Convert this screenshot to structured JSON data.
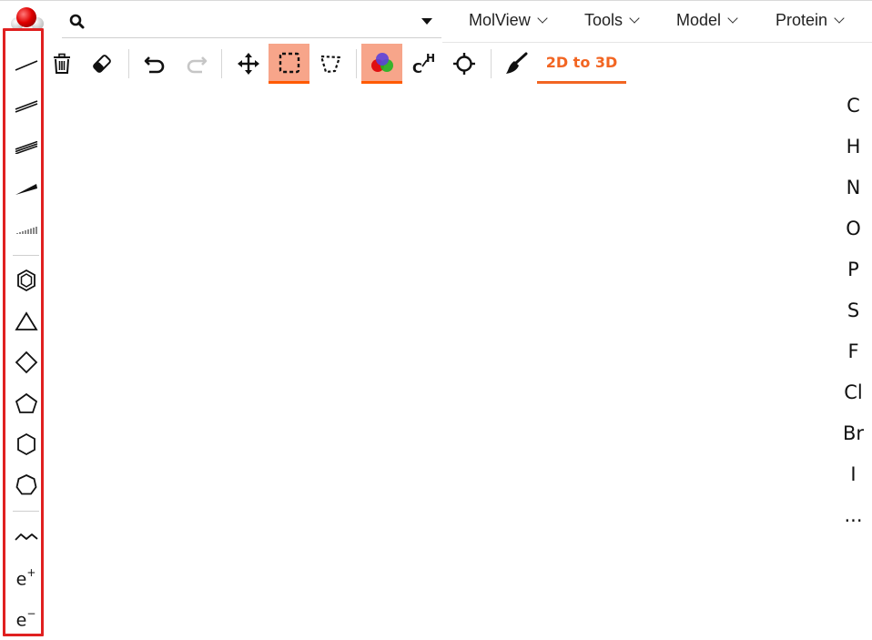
{
  "header": {
    "search": {
      "value": "",
      "placeholder": ""
    },
    "menus": [
      "MolView",
      "Tools",
      "Model",
      "Protein"
    ]
  },
  "toolbar": {
    "buttons": [
      {
        "name": "trash-icon",
        "active": false
      },
      {
        "name": "eraser-icon",
        "active": false
      },
      {
        "name": "undo-icon",
        "active": false
      },
      {
        "name": "redo-icon",
        "active": false,
        "disabled": true
      },
      {
        "name": "move-icon",
        "active": false
      },
      {
        "name": "rect-select-icon",
        "active": true
      },
      {
        "name": "lasso-select-icon",
        "active": false
      },
      {
        "name": "color-atoms-icon",
        "active": true
      },
      {
        "name": "hydrogens-icon",
        "active": false
      },
      {
        "name": "center-icon",
        "active": false
      },
      {
        "name": "clean-icon",
        "active": false
      }
    ],
    "convert_tab_label": "2D to 3D",
    "active_color": "#f7a58a",
    "accent_color": "#f26522"
  },
  "left_panel": {
    "bond_tools": [
      "single-bond-icon",
      "double-bond-icon",
      "triple-bond-icon",
      "wedge-bond-icon",
      "hash-bond-icon"
    ],
    "ring_tools": [
      "benzene-icon",
      "triangle-ring-icon",
      "square-ring-icon",
      "pentagon-ring-icon",
      "hexagon-ring-icon",
      "heptagon-ring-icon"
    ],
    "other_tools": {
      "chain": "chain-icon",
      "charge_plus": {
        "base": "e",
        "sup": "+"
      },
      "charge_minus": {
        "base": "e",
        "sup": "−"
      }
    },
    "highlight_color": "#e02020"
  },
  "elements": [
    "C",
    "H",
    "N",
    "O",
    "P",
    "S",
    "F",
    "Cl",
    "Br",
    "I",
    "..."
  ]
}
